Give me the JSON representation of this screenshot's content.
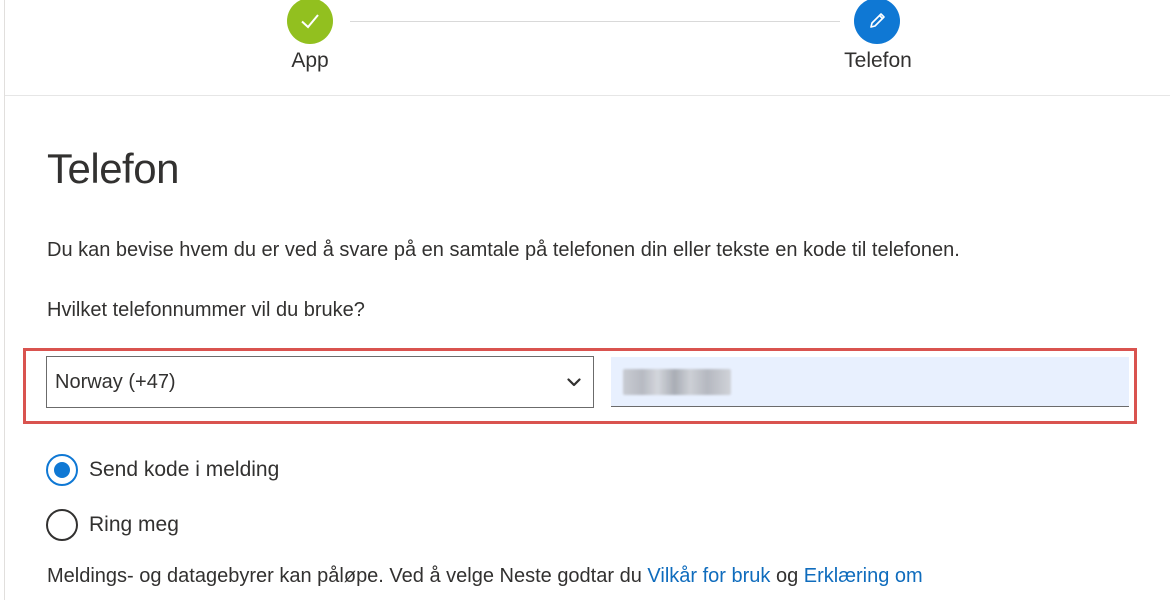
{
  "stepper": {
    "steps": [
      {
        "label": "App",
        "state": "done",
        "icon": "checkmark-icon",
        "color": "#92c01f"
      },
      {
        "label": "Telefon",
        "state": "current",
        "icon": "pencil-icon",
        "color": "#0f78d4"
      }
    ]
  },
  "main": {
    "title": "Telefon",
    "intro": "Du kan bevise hvem du er ved å svare på en samtale på telefonen din eller tekste en kode til telefonen.",
    "question": "Hvilket telefonnummer vil du bruke?",
    "country_select": {
      "value": "Norway (+47)",
      "icon": "chevron-down-icon"
    },
    "phone_input": {
      "value": ""
    },
    "options": [
      {
        "label": "Send kode i melding",
        "checked": true
      },
      {
        "label": "Ring meg",
        "checked": false
      }
    ],
    "terms": {
      "prefix": "Meldings- og datagebyrer kan påløpe. Ved å velge Neste godtar du ",
      "link1": "Vilkår for bruk",
      "middle": " og ",
      "link2": "Erklæring om"
    }
  },
  "colors": {
    "accent": "#0f78d4",
    "success": "#92c01f",
    "highlight": "#d9534f",
    "link": "#0f6cbd"
  }
}
